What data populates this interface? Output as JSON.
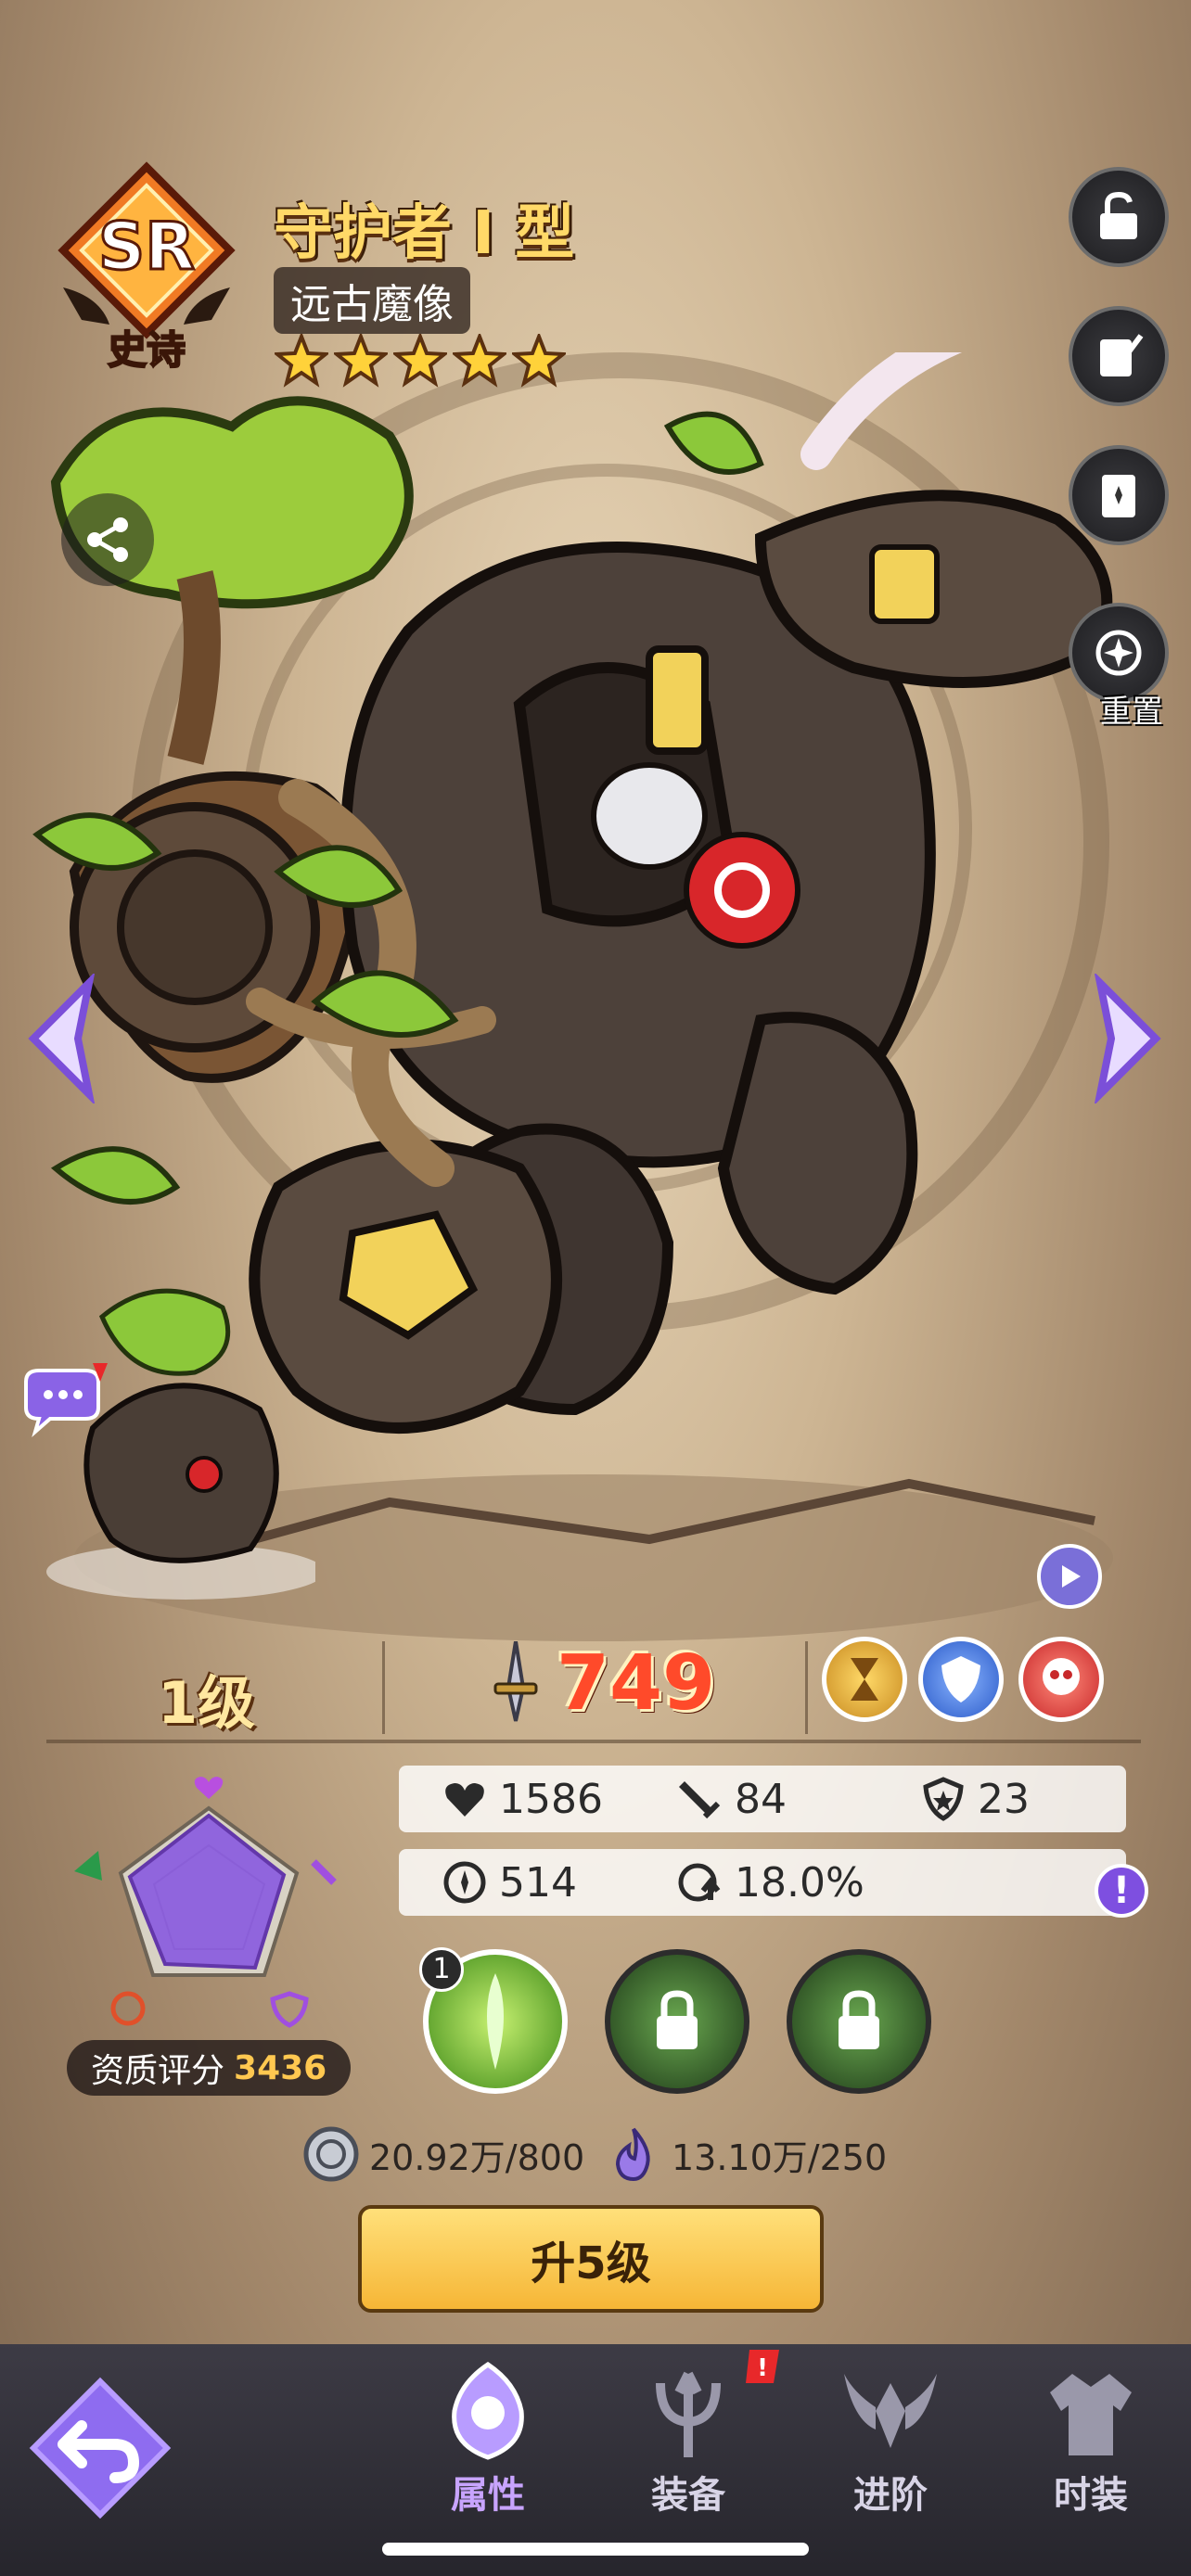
{
  "character": {
    "rarity": "SR",
    "rarity_label": "史诗",
    "name": "守护者 I 型",
    "subtitle": "远古魔像",
    "stars": 5
  },
  "side_buttons": {
    "reset_label": "重置"
  },
  "level": "1级",
  "power": "749",
  "stats": {
    "row1": [
      {
        "icon": "heart-icon",
        "value": "1586"
      },
      {
        "icon": "sword-icon",
        "value": "84"
      },
      {
        "icon": "shield-icon",
        "value": "23"
      }
    ],
    "row2": [
      {
        "icon": "speed-icon",
        "value": "514"
      },
      {
        "icon": "crit-icon",
        "value": "18.0%"
      }
    ]
  },
  "aptitude": {
    "label": "资质评分",
    "value": "3436"
  },
  "skills": {
    "first_level": "1"
  },
  "resources": [
    {
      "icon": "silver-coin-icon",
      "value": "20.92万/800"
    },
    {
      "icon": "spirit-flame-icon",
      "value": "13.10万/250"
    }
  ],
  "upgrade_button_label": "升5级",
  "nav": {
    "tabs": [
      {
        "label": "属性",
        "active": true
      },
      {
        "label": "装备",
        "active": false
      },
      {
        "label": "进阶",
        "active": false
      },
      {
        "label": "时装",
        "active": false
      }
    ]
  },
  "colors": {
    "accent_purple": "#7e4fe0",
    "power_red": "#ff4a2a",
    "gold": "#ffd968"
  }
}
